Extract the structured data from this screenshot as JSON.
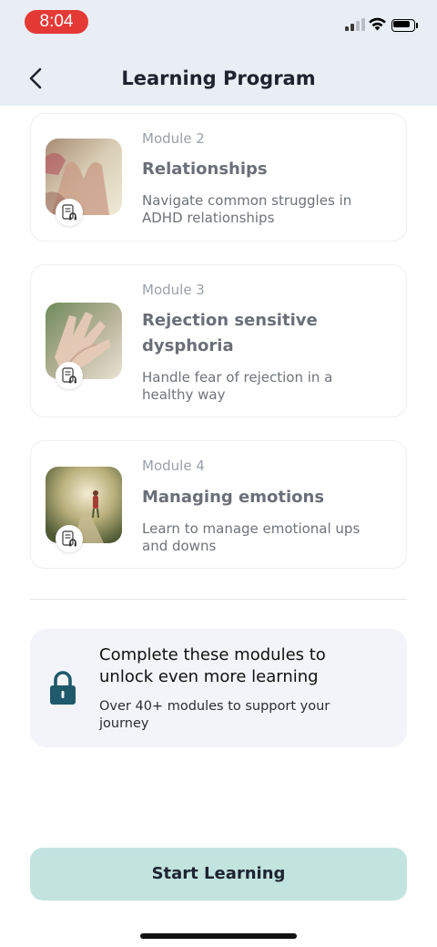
{
  "status_bar": {
    "time": "8:04"
  },
  "header": {
    "title": "Learning Program",
    "back_icon": "chevron-left-icon"
  },
  "modules": [
    {
      "number": "Module 2",
      "title": "Relationships",
      "description": "Navigate common struggles in ADHD relationships",
      "badge_icon": "document-audio-icon"
    },
    {
      "number": "Module 3",
      "title": "Rejection sensitive dysphoria",
      "description": "Handle fear of rejection in a healthy way",
      "badge_icon": "document-audio-icon"
    },
    {
      "number": "Module 4",
      "title": "Managing emotions",
      "description": "Learn to manage emotional ups and downs",
      "badge_icon": "document-audio-icon"
    }
  ],
  "unlock": {
    "title": "Complete these modules to unlock even more learning",
    "subtitle": "Over 40+ modules to support your journey",
    "icon": "lock-icon",
    "icon_color": "#1e5a6b"
  },
  "cta": {
    "label": "Start Learning",
    "color": "#c2e4df"
  },
  "colors": {
    "header_bg": "#e8eef4",
    "status_time_pill": "#e53935"
  }
}
